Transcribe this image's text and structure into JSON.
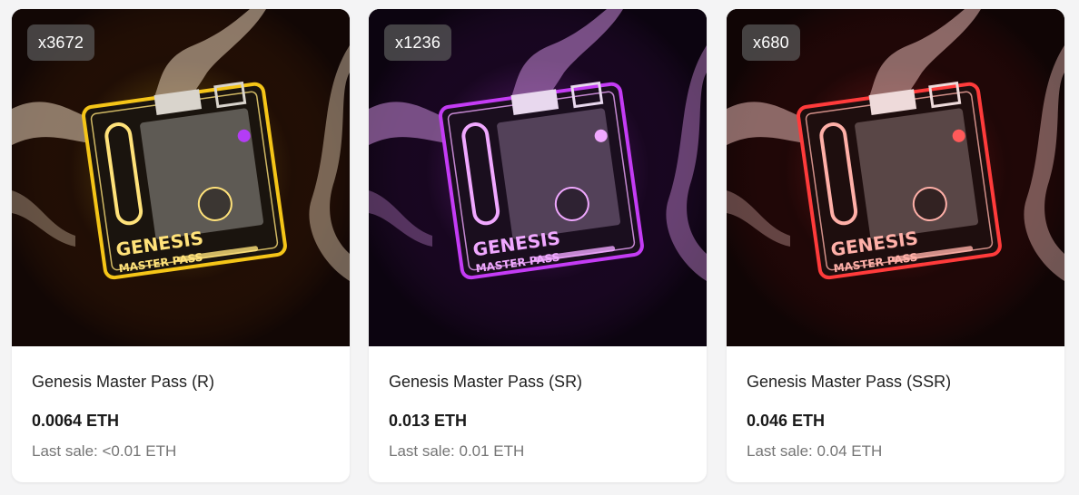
{
  "items": [
    {
      "count_badge": "x3672",
      "name": "Genesis Master Pass (R)",
      "price": "0.0064 ETH",
      "last_sale": "Last sale: <0.01 ETH",
      "glow_color": "#f5c518",
      "glow_light": "#ffe27a",
      "wave_color": "#e8d2b8",
      "bg_color": "#120705"
    },
    {
      "count_badge": "x1236",
      "name": "Genesis Master Pass (SR)",
      "price": "0.013 ETH",
      "last_sale": "Last sale: 0.01 ETH",
      "glow_color": "#c43cf5",
      "glow_light": "#f0a8ff",
      "wave_color": "#c98ad8",
      "bg_color": "#0c0410"
    },
    {
      "count_badge": "x680",
      "name": "Genesis Master Pass (SSR)",
      "price": "0.046 ETH",
      "last_sale": "Last sale: 0.04 ETH",
      "glow_color": "#ff3b3b",
      "glow_light": "#ffb0a8",
      "wave_color": "#e6b8b4",
      "bg_color": "#100505"
    }
  ],
  "pass_art_text": {
    "line1": "GENESIS",
    "line2": "MASTER PASS"
  }
}
